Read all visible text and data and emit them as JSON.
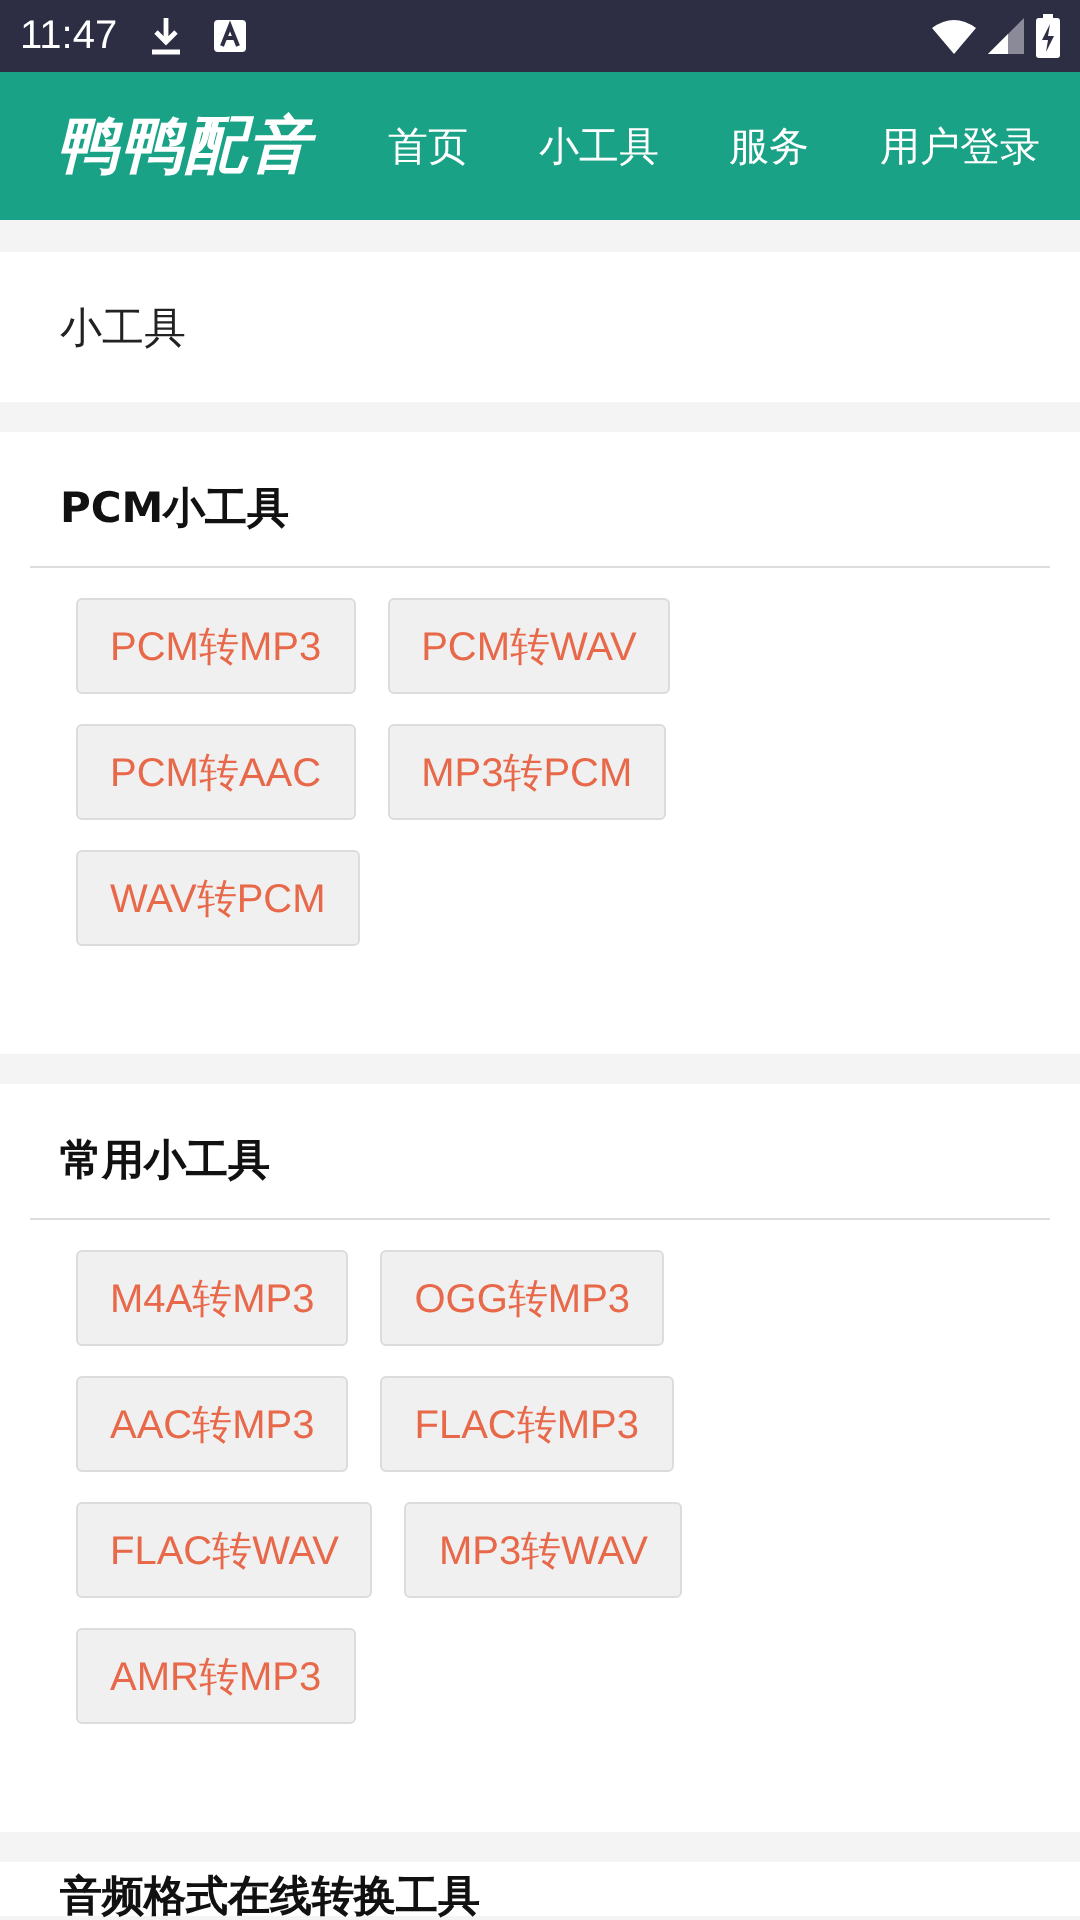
{
  "status_bar": {
    "time": "11:47"
  },
  "header": {
    "logo": "鸭鸭配音",
    "nav": [
      {
        "label": "首页"
      },
      {
        "label": "小工具"
      },
      {
        "label": "服务"
      },
      {
        "label": "用户登录"
      }
    ]
  },
  "page_title": "小工具",
  "sections": [
    {
      "title": "PCM小工具",
      "tools": [
        "PCM转MP3",
        "PCM转WAV",
        "PCM转AAC",
        "MP3转PCM",
        "WAV转PCM"
      ]
    },
    {
      "title": "常用小工具",
      "tools": [
        "M4A转MP3",
        "OGG转MP3",
        "AAC转MP3",
        "FLAC转MP3",
        "FLAC转WAV",
        "MP3转WAV",
        "AMR转MP3"
      ]
    },
    {
      "title": "音频格式在线转换工具"
    }
  ]
}
